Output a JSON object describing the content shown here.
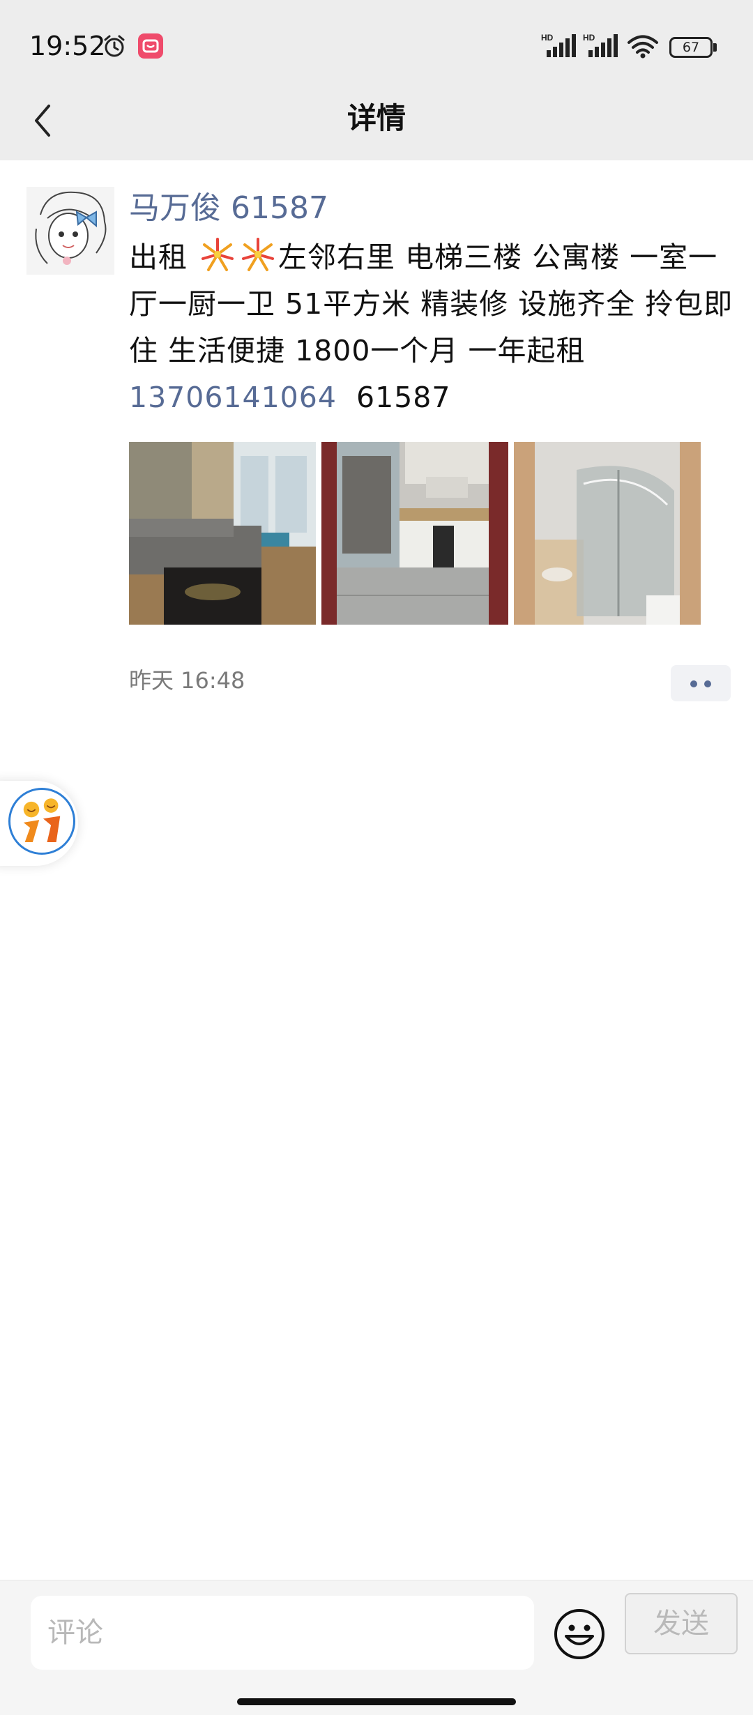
{
  "status_bar": {
    "time": "19:52",
    "battery": "67",
    "signal_labels": [
      "HD",
      "HD"
    ]
  },
  "header": {
    "title": "详情"
  },
  "post": {
    "username": "马万俊 61587",
    "content_prefix": "出租",
    "content_main": "左邻右里  电梯三楼 公寓楼  一室一厅一厨一卫  51平方米  精装修  设施齐全 拎包即住 生活便捷 1800一个月  一年起租",
    "phone": "13706141064",
    "content_suffix": "  61587",
    "emoji_icons": [
      "fireworks-icon",
      "fireworks-icon"
    ],
    "photos": [
      {
        "name": "living-room-photo"
      },
      {
        "name": "kitchen-photo"
      },
      {
        "name": "bathroom-photo"
      }
    ],
    "time": "昨天 16:48"
  },
  "comment_bar": {
    "placeholder": "评论",
    "send_label": "发送"
  },
  "colors": {
    "link_blue": "#576b95",
    "header_bg": "#ededed"
  }
}
